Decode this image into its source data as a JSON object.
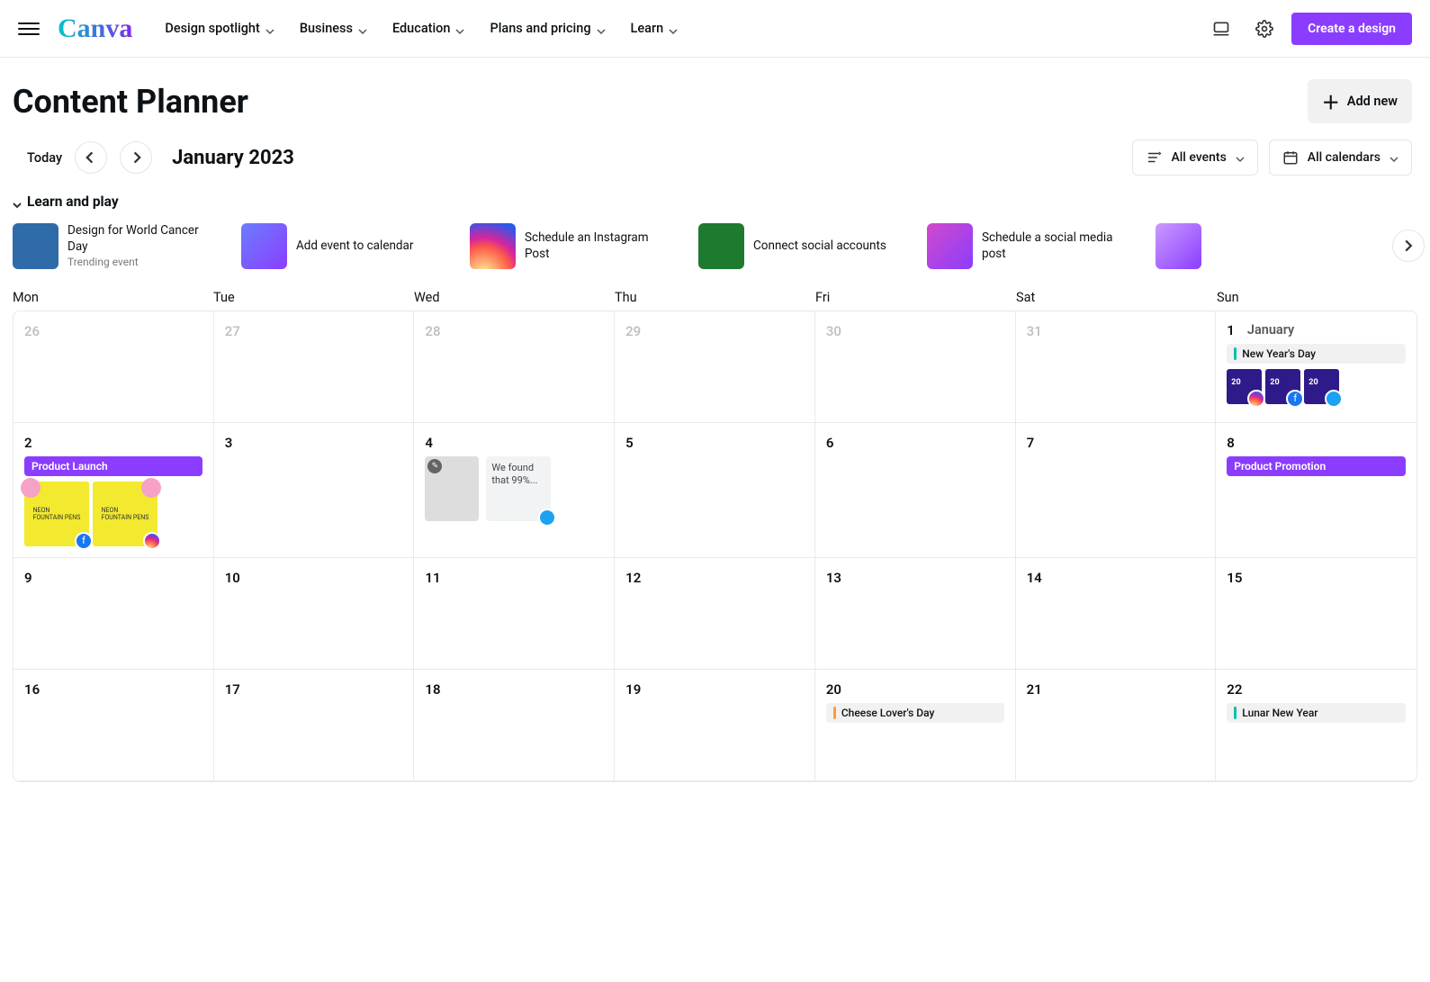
{
  "nav": {
    "items": [
      "Design spotlight",
      "Business",
      "Education",
      "Plans and pricing",
      "Learn"
    ],
    "cta": "Create a design"
  },
  "header": {
    "title": "Content Planner",
    "addNew": "Add new"
  },
  "controls": {
    "today": "Today",
    "month": "January 2023",
    "eventsFilter": "All events",
    "calendarsFilter": "All calendars"
  },
  "learn": {
    "title": "Learn and play",
    "cards": [
      {
        "title": "Design for World Cancer Day",
        "sub": "Trending event"
      },
      {
        "title": "Add event to calendar",
        "sub": ""
      },
      {
        "title": "Schedule an Instagram Post",
        "sub": ""
      },
      {
        "title": "Connect social accounts",
        "sub": ""
      },
      {
        "title": "Schedule a social media post",
        "sub": ""
      }
    ]
  },
  "weekdays": [
    "Mon",
    "Tue",
    "Wed",
    "Thu",
    "Fri",
    "Sat",
    "Sun"
  ],
  "monthName": "January",
  "cells": {
    "r0": [
      "26",
      "27",
      "28",
      "29",
      "30",
      "31",
      "1"
    ],
    "r1": [
      "2",
      "3",
      "4",
      "5",
      "6",
      "7",
      "8"
    ],
    "r2": [
      "9",
      "10",
      "11",
      "12",
      "13",
      "14",
      "15"
    ],
    "r3": [
      "16",
      "17",
      "18",
      "19",
      "20",
      "21",
      "22"
    ]
  },
  "events": {
    "newYear": "New Year's Day",
    "productLaunch": "Product Launch",
    "productPromotion": "Product Promotion",
    "cheese": "Cheese Lover's Day",
    "lunar": "Lunar New Year",
    "draftText": "We found that 99%..."
  }
}
